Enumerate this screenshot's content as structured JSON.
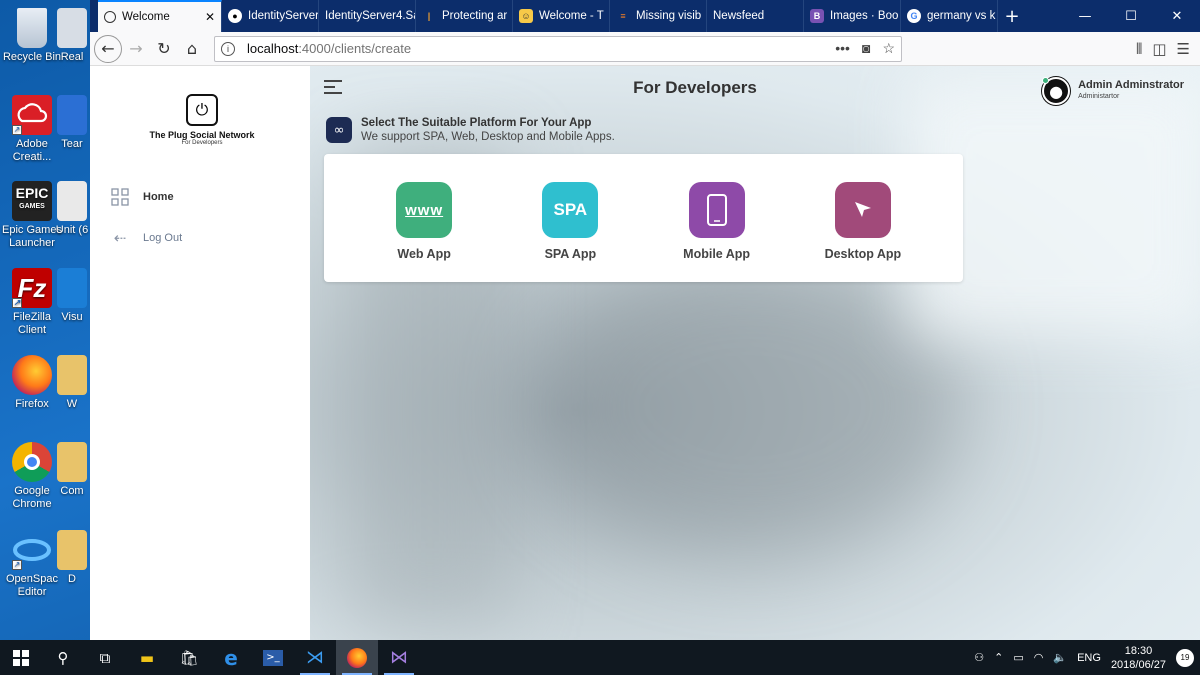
{
  "desktop": {
    "icons": [
      {
        "label": "Recycle Bin",
        "name": "recycle-bin-icon"
      },
      {
        "label": "Real",
        "name": "realvnc-icon"
      },
      {
        "label": "Adobe Creati...",
        "name": "adobe-creative-cloud-icon"
      },
      {
        "label": "Tear",
        "name": "teams-icon"
      },
      {
        "label": "Epic Games Launcher",
        "name": "epic-games-icon"
      },
      {
        "label": "Unit (6",
        "name": "unity-icon"
      },
      {
        "label": "FileZilla Client",
        "name": "filezilla-icon"
      },
      {
        "label": "Visu",
        "name": "visual-studio-icon"
      },
      {
        "label": "Firefox",
        "name": "firefox-icon"
      },
      {
        "label": "W",
        "name": "folder-icon"
      },
      {
        "label": "Google Chrome",
        "name": "chrome-icon"
      },
      {
        "label": "Com",
        "name": "folder-icon"
      },
      {
        "label": "OpenSpac Editor",
        "name": "openspace-icon"
      },
      {
        "label": "D",
        "name": "folder-icon"
      }
    ]
  },
  "browser": {
    "tabs": [
      {
        "label": "Welcome",
        "active": true
      },
      {
        "label": "IdentityServer",
        "active": false
      },
      {
        "label": "IdentityServer4.Sa",
        "active": false
      },
      {
        "label": "Protecting ar",
        "active": false
      },
      {
        "label": "Welcome - T",
        "active": false
      },
      {
        "label": "Missing visib",
        "active": false
      },
      {
        "label": "Newsfeed",
        "active": false
      },
      {
        "label": "Images · Boo",
        "active": false
      },
      {
        "label": "germany vs k",
        "active": false
      }
    ],
    "url_host": "localhost",
    "url_path": ":4000/clients/create"
  },
  "app": {
    "logo": {
      "name": "The Plug Social Network",
      "subtitle": "For Developers"
    },
    "nav": {
      "home": "Home",
      "logout": "Log Out"
    },
    "page_title": "For Developers",
    "user": {
      "name": "Admin Adminstrator",
      "role": "Administartor"
    },
    "notice": {
      "heading": "Select The Suitable Platform For Your App",
      "text": "We support SPA, Web, Desktop and Mobile Apps."
    },
    "platforms": [
      {
        "label": "Web App",
        "tile_text": "www",
        "color": "#3faf7d"
      },
      {
        "label": "SPA App",
        "tile_text": "SPA",
        "color": "#2fbfcf"
      },
      {
        "label": "Mobile App",
        "tile_text": "",
        "color": "#8e4aa8"
      },
      {
        "label": "Desktop App",
        "tile_text": "",
        "color": "#a14a7a"
      }
    ]
  },
  "taskbar": {
    "language": "ENG",
    "time": "18:30",
    "date": "2018/06/27",
    "notifications": "19"
  }
}
